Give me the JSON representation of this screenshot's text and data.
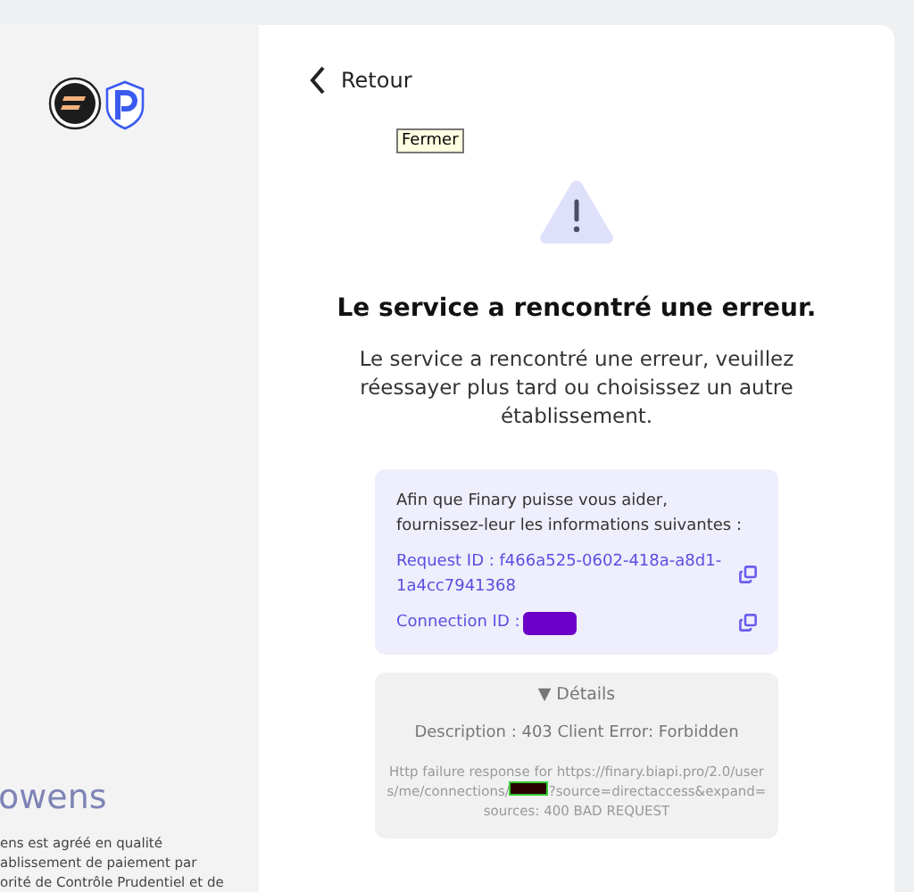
{
  "sidebar": {
    "brand": "owens",
    "legal_lines": [
      "ens est agréé en qualité",
      "ablissement de paiement par",
      "orité de Contrôle Prudentiel et de"
    ]
  },
  "back_link": "Retour",
  "tooltip": "Fermer",
  "title": "Le service a rencontré une erreur.",
  "message": "Le service a rencontré une erreur, veuillez réessayer plus tard ou choisissez un autre établissement.",
  "info_box": {
    "intro": "Afin que Finary puisse vous aider, fournissez-leur les informations suivantes :",
    "fields": [
      {
        "label": "Request ID : f466a525-0602-418a-a8d1-1a4cc7941368",
        "redacted": false
      },
      {
        "label": "Connection ID :",
        "redacted": true
      }
    ]
  },
  "details": {
    "toggle": "▼ Détails",
    "description": "Description : 403 Client Error: Forbidden",
    "error_before": "Http failure response for https://finary.biapi.pro/2.0/users/me/connections/",
    "error_after": "?source=directaccess&expand=sources: 400 BAD REQUEST"
  }
}
